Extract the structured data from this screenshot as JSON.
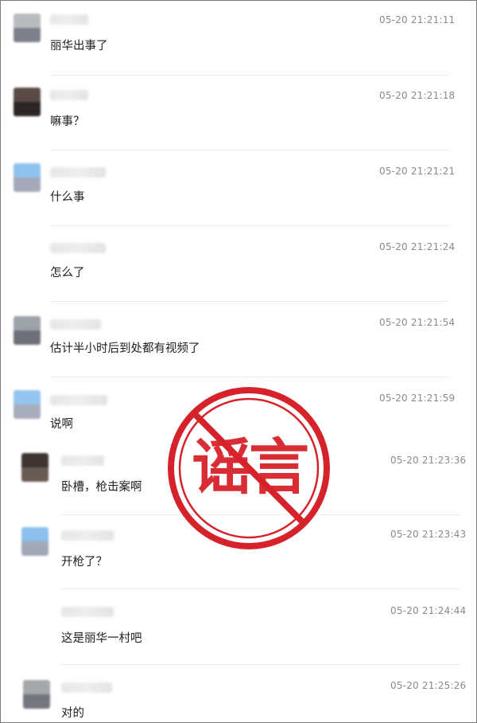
{
  "messages": [
    {
      "time": "05-20 21:21:11",
      "text": "丽华出事了",
      "avatar": "grey-photo-avatar"
    },
    {
      "time": "05-20 21:21:18",
      "text": "嘛事？",
      "avatar": "dark-photo-avatar"
    },
    {
      "time": "05-20 21:21:21",
      "text": "什么事",
      "avatar": "blue-photo-avatar"
    },
    {
      "time": "05-20 21:21:24",
      "text": "怎么了",
      "avatar": "none"
    },
    {
      "time": "05-20 21:21:54",
      "text": "估计半小时后到处都有视频了",
      "avatar": "grey-photo-avatar"
    },
    {
      "time": "05-20 21:21:59",
      "text": "说啊",
      "avatar": "blue-photo-avatar"
    },
    {
      "time": "05-20 21:23:36",
      "text": "卧槽，枪击案啊",
      "avatar": "dark-photo-avatar"
    },
    {
      "time": "05-20 21:23:43",
      "text": "开枪了？",
      "avatar": "blue-photo-avatar"
    },
    {
      "time": "05-20 21:24:44",
      "text": "这是丽华一村吧",
      "avatar": "none"
    },
    {
      "time": "05-20 21:25:26",
      "text": "对的",
      "avatar": "grey-photo-avatar"
    }
  ],
  "stamp": {
    "text": "谣言",
    "color": "#d6222b",
    "icon": "rumor-stamp-icon"
  }
}
